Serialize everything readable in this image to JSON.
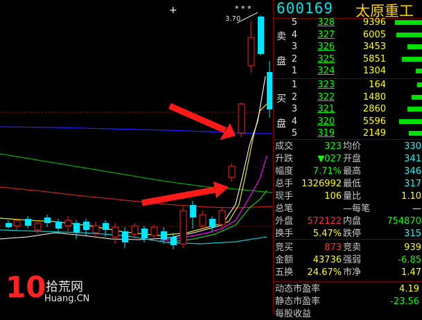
{
  "chart": {
    "peak_label": "3.70",
    "peak_marker": "* * *",
    "top_marker": "+"
  },
  "stock": {
    "code": "600169",
    "name": "太原重工"
  },
  "orderbook": {
    "sell_label": [
      "卖",
      "盘"
    ],
    "buy_label": [
      "买",
      "盘"
    ],
    "sell": [
      {
        "level": "5",
        "price": "328",
        "volume": "9396"
      },
      {
        "level": "4",
        "price": "327",
        "volume": "6005"
      },
      {
        "level": "3",
        "price": "326",
        "volume": "3453"
      },
      {
        "level": "2",
        "price": "325",
        "volume": "5851"
      },
      {
        "level": "1",
        "price": "324",
        "volume": "1304"
      }
    ],
    "buy": [
      {
        "level": "1",
        "price": "323",
        "volume": "164"
      },
      {
        "level": "2",
        "price": "322",
        "volume": "1480"
      },
      {
        "level": "3",
        "price": "321",
        "volume": "2860"
      },
      {
        "level": "4",
        "price": "320",
        "volume": "5596"
      },
      {
        "level": "5",
        "price": "319",
        "volume": "2149"
      }
    ]
  },
  "stats": [
    {
      "l1": "成交",
      "v1": "323",
      "l2": "均价",
      "v2": "330"
    },
    {
      "l1": "升跌",
      "v1": "▼027",
      "l2": "开盘",
      "v2": "341"
    },
    {
      "l1": "幅度",
      "v1": "7.71%",
      "l2": "最高",
      "v2": "346"
    },
    {
      "l1": "总手",
      "v1": "1326992",
      "l2": "最低",
      "v2": "317"
    },
    {
      "l1": "现手",
      "v1": "106",
      "l2": "量比",
      "v2": "1.10"
    },
    {
      "l1": "总笔",
      "v1": "",
      "l2": "—每笔",
      "v2": "—"
    },
    {
      "l1": "外盘",
      "v1": "572122",
      "l2": "内盘",
      "v2": "754870"
    },
    {
      "l1": "换手",
      "v1": "5.47%",
      "l2": "跌停",
      "v2": "315"
    }
  ],
  "stats2": [
    {
      "l1": "竞买",
      "v1": "873",
      "l2": "竞卖",
      "v2": "939"
    },
    {
      "l1": "金额",
      "v1": "43736",
      "l2": "强弱",
      "v2": "-6.85"
    },
    {
      "l1": "五换",
      "v1": "24.67%",
      "l2": "市净",
      "v2": "1.47"
    }
  ],
  "pe": [
    {
      "label": "动态市盈率",
      "value": "4.19"
    },
    {
      "label": "静态市盈率",
      "value": "-23.56"
    },
    {
      "label": "每股收益",
      "value": ""
    }
  ],
  "watermark": {
    "number": "10",
    "name": "拾荒网",
    "url": "Huang.CN"
  },
  "colors": {
    "up": "#ff2020",
    "down": "#00ffff",
    "price": "#00ff00",
    "label": "#c8c8c8",
    "arrow": "#ff1a1a"
  }
}
